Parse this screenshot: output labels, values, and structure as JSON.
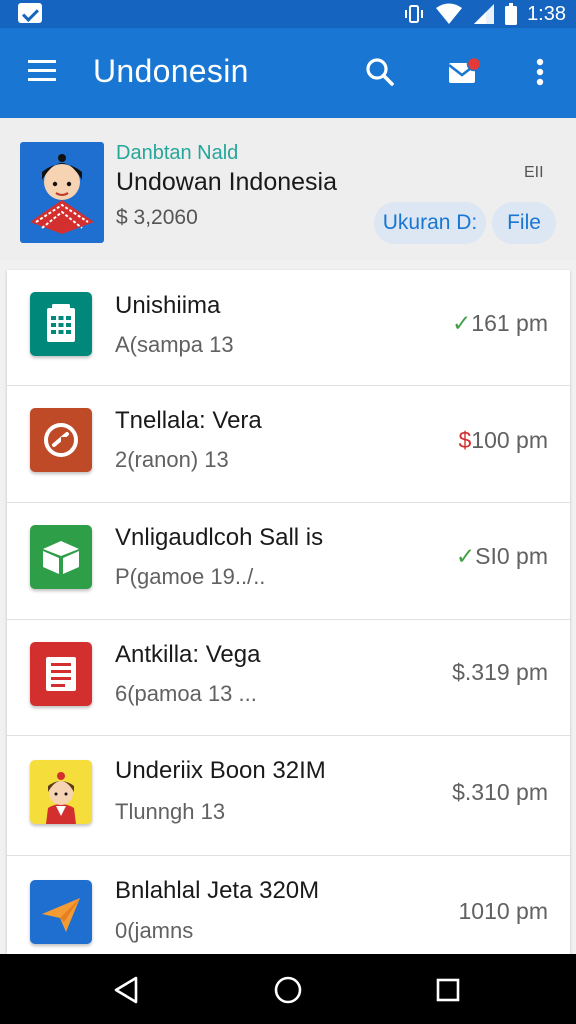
{
  "status_bar": {
    "time": "1:38",
    "icons": [
      "notification-icon",
      "vibrate-icon",
      "wifi-icon",
      "signal-icon",
      "battery-icon"
    ]
  },
  "app_bar": {
    "title": "Undonesin",
    "icons": [
      "menu-icon",
      "search-icon",
      "notification-badge-icon",
      "more-vert-icon"
    ]
  },
  "account": {
    "subtitle": "Danbtan Nald",
    "name": "Undowan Indonesia",
    "amount": "$ 3,2060",
    "corner_label": "EII",
    "chips": [
      "Ukuran D:",
      "File"
    ]
  },
  "transactions": [
    {
      "title": "Unishiima",
      "subtitle": "A(sampa  13",
      "amount_prefix": "✓",
      "amount": "161 pm",
      "prefix_color": "#43a047",
      "icon": "calendar-table-icon",
      "icon_color": "#00897b"
    },
    {
      "title": "Tnellala: Vera",
      "subtitle": "2(ranon)  13",
      "amount_prefix": "$",
      "amount": "100 pm",
      "prefix_color": "#d32f2f",
      "icon": "gauge-icon",
      "icon_color": "#bf4a27"
    },
    {
      "title": "Vnligaudlcoh Sall is",
      "subtitle": "P(gamoe  19../..",
      "amount_prefix": "✓",
      "amount": "SI0 pm",
      "prefix_color": "#43a047",
      "icon": "box-icon",
      "icon_color": "#2e9e48"
    },
    {
      "title": "Antkilla: Vega",
      "subtitle": "6(pamoa  13 ...",
      "amount_prefix": "",
      "amount": "$.319 pm",
      "prefix_color": "",
      "icon": "document-icon",
      "icon_color": "#d32f2f"
    },
    {
      "title": "Underiix Boon 32IM",
      "subtitle": "Tlunngh  13",
      "amount_prefix": "",
      "amount": "$.310 pm",
      "prefix_color": "",
      "icon": "person-avatar-icon",
      "icon_color": "#f5dd3b"
    },
    {
      "title": "Bnlahlal Jeta 320M",
      "subtitle": "0(jamns",
      "amount_prefix": "",
      "amount": "1010 pm",
      "prefix_color": "",
      "icon": "send-plane-icon",
      "icon_color": "#1e6fd0"
    }
  ],
  "nav_bar": {
    "icons": [
      "back-icon",
      "home-icon",
      "recents-icon"
    ]
  }
}
